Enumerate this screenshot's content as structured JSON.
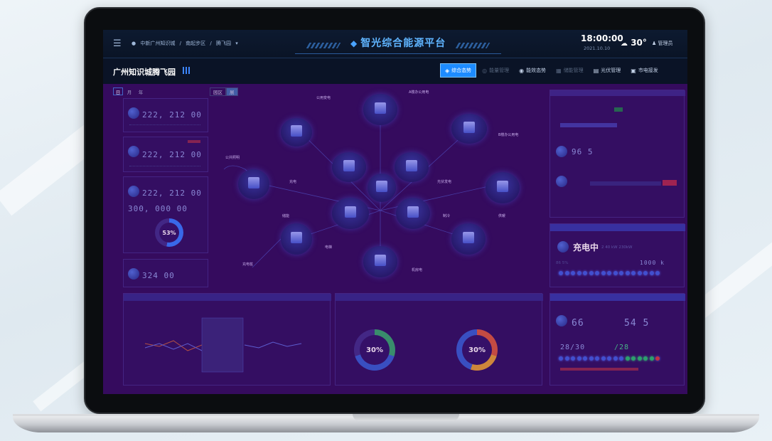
{
  "topbar": {
    "menu_icon": "menu-icon",
    "location_icon": "pin-icon",
    "breadcrumb": [
      "中新广州知识城",
      "/",
      "南起步区",
      "/",
      "腾飞园"
    ],
    "dropdown_icon": "chevron-down-icon",
    "title": "智光综合能源平台",
    "time": "18:00:00",
    "date": "2021.10.10",
    "weather_icon": "cloud-icon",
    "temperature": "30°",
    "user_icon": "user-icon",
    "user": "管理员"
  },
  "subbar": {
    "park_name": "广州知识城腾飞园",
    "tabs": [
      {
        "label": "综合态势",
        "active": true
      },
      {
        "label": "能量管理",
        "active": false
      },
      {
        "label": "能效态势",
        "active": false
      },
      {
        "label": "储能管理",
        "active": false
      },
      {
        "label": "光伏管理",
        "active": false
      },
      {
        "label": "市电接发",
        "active": false
      }
    ]
  },
  "controls": {
    "periods": [
      "日",
      "月",
      "年"
    ],
    "views": [
      "园区",
      "展"
    ]
  },
  "left_stats": [
    {
      "value": "222, 212 00"
    },
    {
      "value": "222, 212 00"
    },
    {
      "value": "222, 212 00",
      "value2": "300, 000 00",
      "percent": "53%"
    },
    {
      "value": "324 00"
    }
  ],
  "diagram": {
    "labels": [
      "公用变电",
      "A楼办公用电",
      "B楼办公用电",
      "公共照明",
      "充电",
      "光伏发电",
      "供暖",
      "储能",
      "制冷",
      "电梯",
      "充电桩",
      "机房电"
    ]
  },
  "right_panels": {
    "kpi_value": "96 5",
    "charge_title": "充电中",
    "charge_rate": "2 40 kW 230kW",
    "charge_left": "86 5%",
    "charge_right": "1000 k",
    "bottom_value_a": "66",
    "bottom_value_b": "54 5",
    "ratio_a": "28/30",
    "ratio_b": "/28"
  },
  "bottom_charts": {
    "donut_a": "30%",
    "donut_b": "30%"
  }
}
